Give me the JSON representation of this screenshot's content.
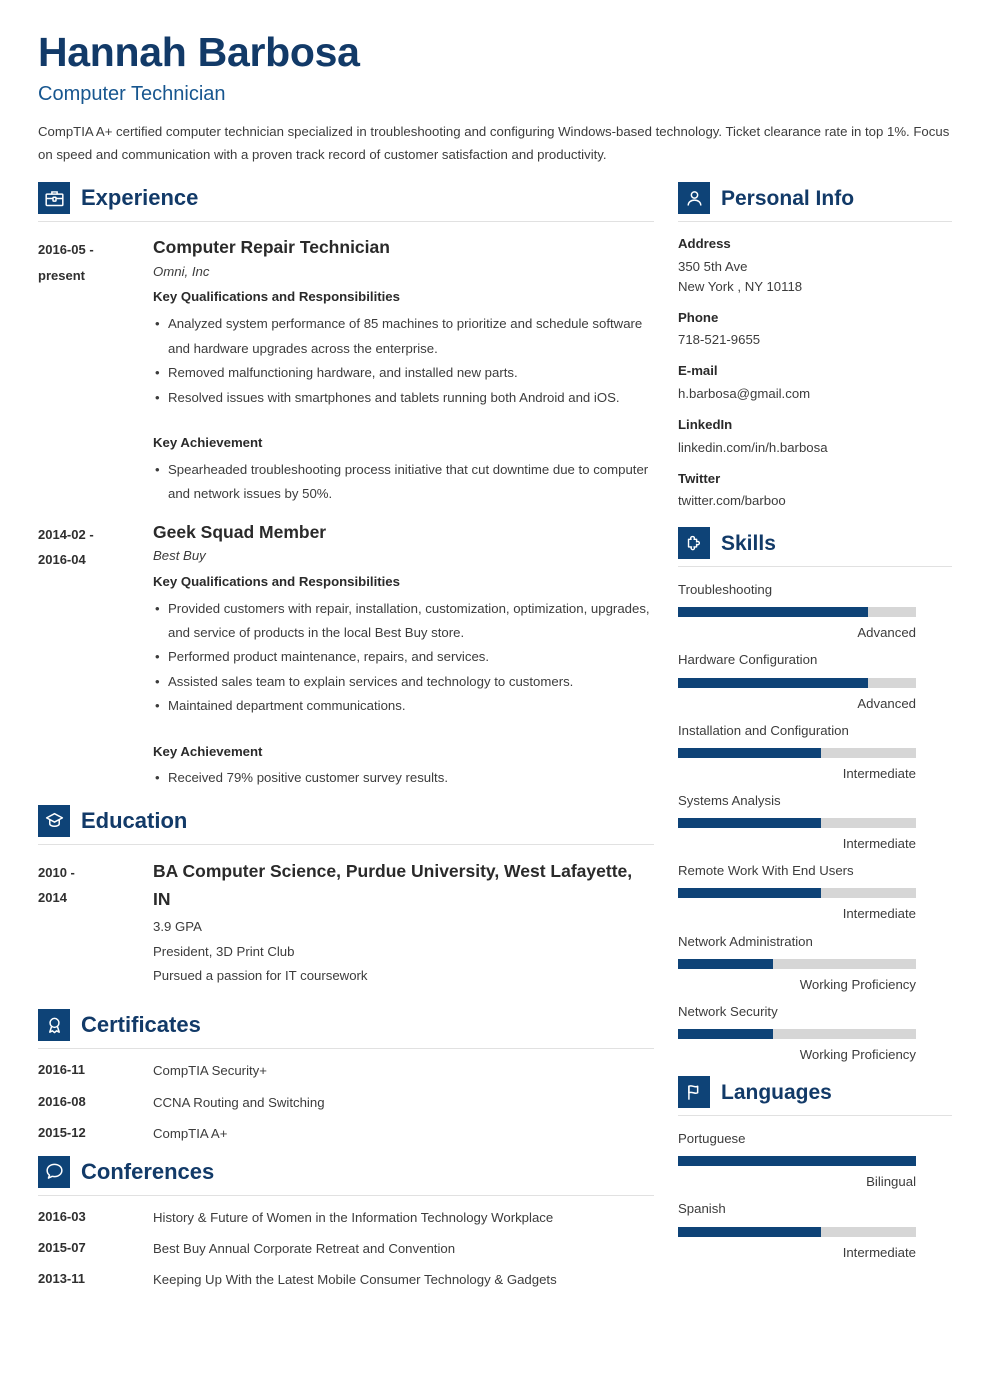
{
  "header": {
    "name": "Hannah Barbosa",
    "title": "Computer Technician",
    "summary": "CompTIA A+ certified computer technician specialized in troubleshooting and configuring Windows-based technology. Ticket clearance rate in top 1%. Focus on speed and communication with a proven track record of customer satisfaction and productivity."
  },
  "colors": {
    "accent_dark": "#0e4377",
    "heading": "#123a68",
    "subtitle": "#17568f",
    "bar_track": "#d6d6d6",
    "body_text": "#3c3c3c"
  },
  "sections": {
    "experience": {
      "title": "Experience",
      "icon": "briefcase-icon",
      "entries": [
        {
          "date": "2016-05 - present",
          "date_line1": "2016-05 -",
          "date_line2": "present",
          "role": "Computer Repair Technician",
          "org": "Omni, Inc",
          "qual_heading": "Key Qualifications and Responsibilities",
          "bullets": [
            "Analyzed system performance of 85 machines to prioritize and schedule software and hardware upgrades across the enterprise.",
            "Removed malfunctioning hardware, and installed new parts.",
            "Resolved issues with smartphones and tablets running both Android and iOS."
          ],
          "achievement_heading": "Key Achievement",
          "achievements": [
            "Spearheaded troubleshooting process initiative that cut downtime due to computer and network issues by 50%."
          ]
        },
        {
          "date": "2014-02 - 2016-04",
          "date_line1": "2014-02 -",
          "date_line2": "2016-04",
          "role": "Geek Squad Member",
          "org": "Best Buy",
          "qual_heading": "Key Qualifications and Responsibilities",
          "bullets": [
            "Provided customers with repair, installation, customization, optimization, upgrades, and service of products in the local Best Buy store.",
            "Performed product maintenance, repairs, and services.",
            "Assisted sales team to explain services and technology to customers.",
            "Maintained department communications."
          ],
          "achievement_heading": "Key Achievement",
          "achievements": [
            "Received 79% positive customer survey results."
          ]
        }
      ]
    },
    "education": {
      "title": "Education",
      "icon": "graduation-cap-icon",
      "entries": [
        {
          "date_line1": "2010 -",
          "date_line2": "2014",
          "degree": "BA Computer Science, Purdue University, West Lafayette, IN",
          "details": [
            "3.9 GPA",
            "President, 3D Print Club",
            "Pursued a passion for IT coursework"
          ]
        }
      ]
    },
    "certificates": {
      "title": "Certificates",
      "icon": "award-ribbon-icon",
      "rows": [
        {
          "date": "2016-11",
          "text": "CompTIA Security+"
        },
        {
          "date": "2016-08",
          "text": "CCNA Routing and Switching"
        },
        {
          "date": "2015-12",
          "text": "CompTIA A+"
        }
      ]
    },
    "conferences": {
      "title": "Conferences",
      "icon": "speech-bubble-icon",
      "rows": [
        {
          "date": "2016-03",
          "text": "History & Future of Women in the Information Technology Workplace"
        },
        {
          "date": "2015-07",
          "text": "Best Buy Annual Corporate Retreat and Convention"
        },
        {
          "date": "2013-11",
          "text": "Keeping Up With the Latest Mobile Consumer Technology & Gadgets"
        }
      ]
    },
    "personal_info": {
      "title": "Personal Info",
      "icon": "person-icon",
      "blocks": [
        {
          "label": "Address",
          "value_line1": "350 5th Ave",
          "value_line2": "New York , NY 10118"
        },
        {
          "label": "Phone",
          "value_line1": "718-521-9655"
        },
        {
          "label": "E-mail",
          "value_line1": "h.barbosa@gmail.com"
        },
        {
          "label": "LinkedIn",
          "value_line1": "linkedin.com/in/h.barbosa"
        },
        {
          "label": "Twitter",
          "value_line1": "twitter.com/barboo"
        }
      ]
    },
    "skills": {
      "title": "Skills",
      "icon": "puzzle-piece-icon",
      "items": [
        {
          "name": "Troubleshooting",
          "level": "Advanced",
          "percent": 80
        },
        {
          "name": "Hardware Configuration",
          "level": "Advanced",
          "percent": 80
        },
        {
          "name": "Installation and Configuration",
          "level": "Intermediate",
          "percent": 60
        },
        {
          "name": "Systems Analysis",
          "level": "Intermediate",
          "percent": 60
        },
        {
          "name": "Remote Work With End Users",
          "level": "Intermediate",
          "percent": 60
        },
        {
          "name": "Network Administration",
          "level": "Working Proficiency",
          "percent": 40
        },
        {
          "name": "Network Security",
          "level": "Working Proficiency",
          "percent": 40
        }
      ]
    },
    "languages": {
      "title": "Languages",
      "icon": "flag-icon",
      "items": [
        {
          "name": "Portuguese",
          "level": "Bilingual",
          "percent": 100
        },
        {
          "name": "Spanish",
          "level": "Intermediate",
          "percent": 60
        }
      ]
    }
  }
}
